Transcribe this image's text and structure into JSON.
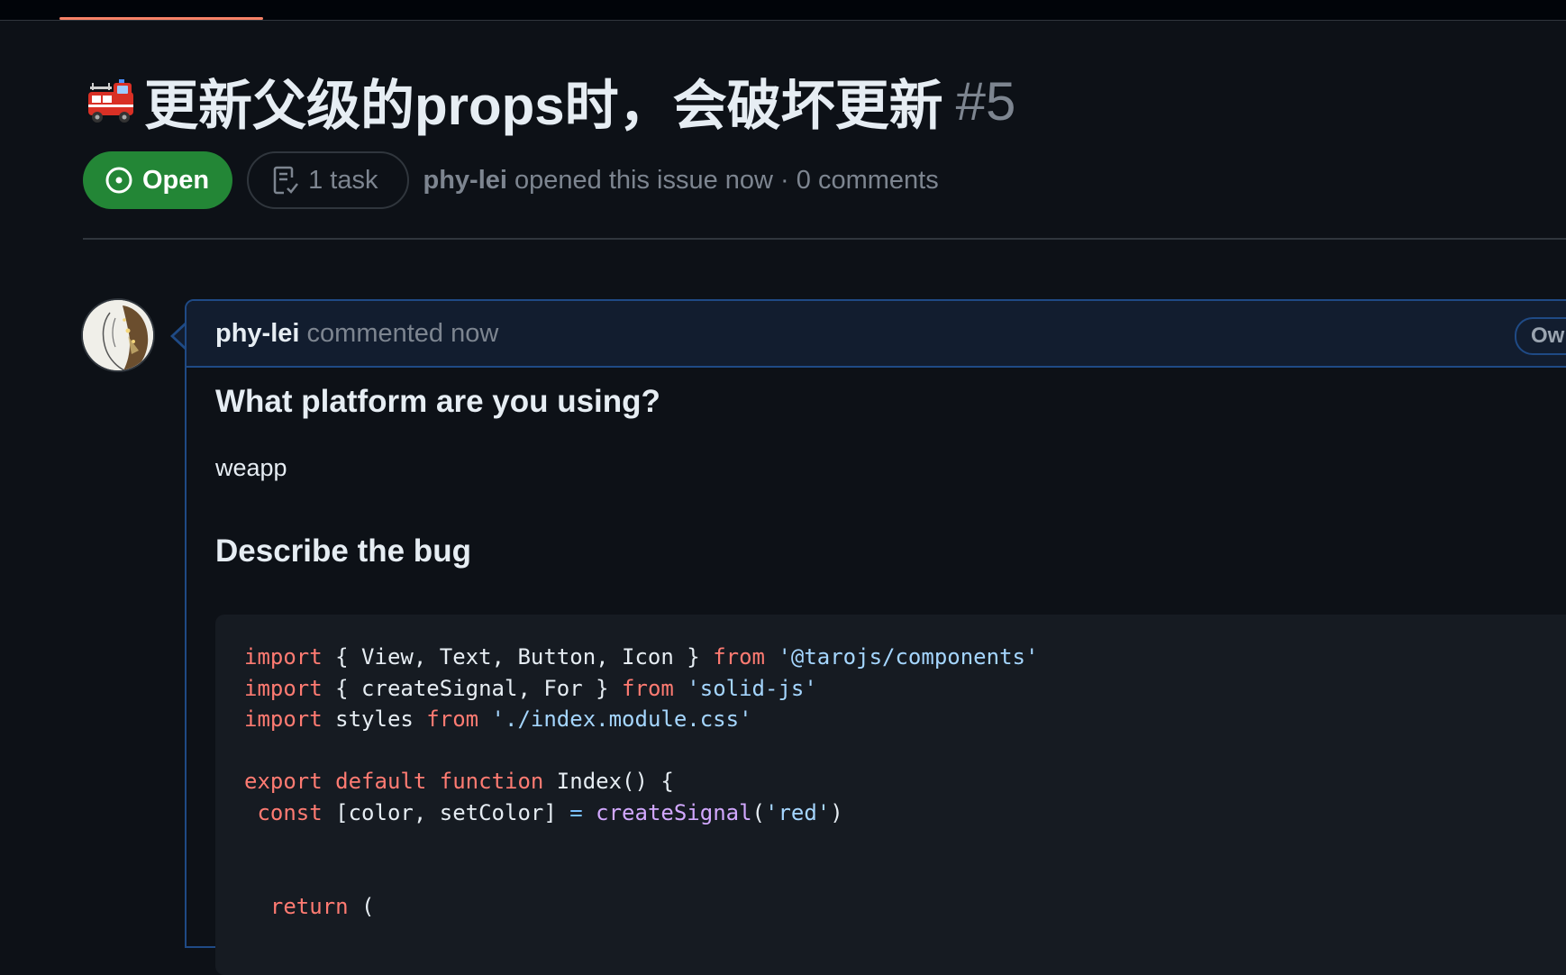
{
  "issue": {
    "title_emoji": "fire-engine-icon",
    "title": "更新父级的props时，会破坏更新",
    "number": "#5",
    "state": "Open",
    "task_count": "1 task",
    "author": "phy-lei",
    "opened_text": "opened this issue now · 0 comments"
  },
  "comment": {
    "author": "phy-lei",
    "time": "commented now",
    "badge": "Owner",
    "platform_heading": "What platform are you using?",
    "platform_value": "weapp",
    "bug_heading": "Describe the bug",
    "code": {
      "line1": {
        "k1": "import",
        "t1": " { View, Text, Button, Icon } ",
        "k2": "from",
        "t2": " ",
        "s1": "'@tarojs/components'"
      },
      "line2": {
        "k1": "import",
        "t1": " { createSignal, For } ",
        "k2": "from",
        "t2": " ",
        "s1": "'solid-js'"
      },
      "line3": {
        "k1": "import",
        "t1": " styles ",
        "k2": "from",
        "t2": " ",
        "s1": "'./index.module.css'"
      },
      "line5": {
        "k1": "export",
        "k2": "default",
        "k3": "function",
        "t1": " Index() {"
      },
      "line6": {
        "k1": " const",
        "t1": " [color, setColor] ",
        "o1": "=",
        "f1": " createSignal",
        "t2": "(",
        "s1": "'red'",
        "t3": ")"
      },
      "line9": {
        "k1": "  return",
        "t1": " ("
      }
    }
  },
  "colors": {
    "background": "#0d1117",
    "open_badge": "#238636",
    "accent_border": "#1f4a85",
    "keyword": "#ff7b72",
    "string": "#a5d6ff",
    "function": "#d2a8ff"
  }
}
